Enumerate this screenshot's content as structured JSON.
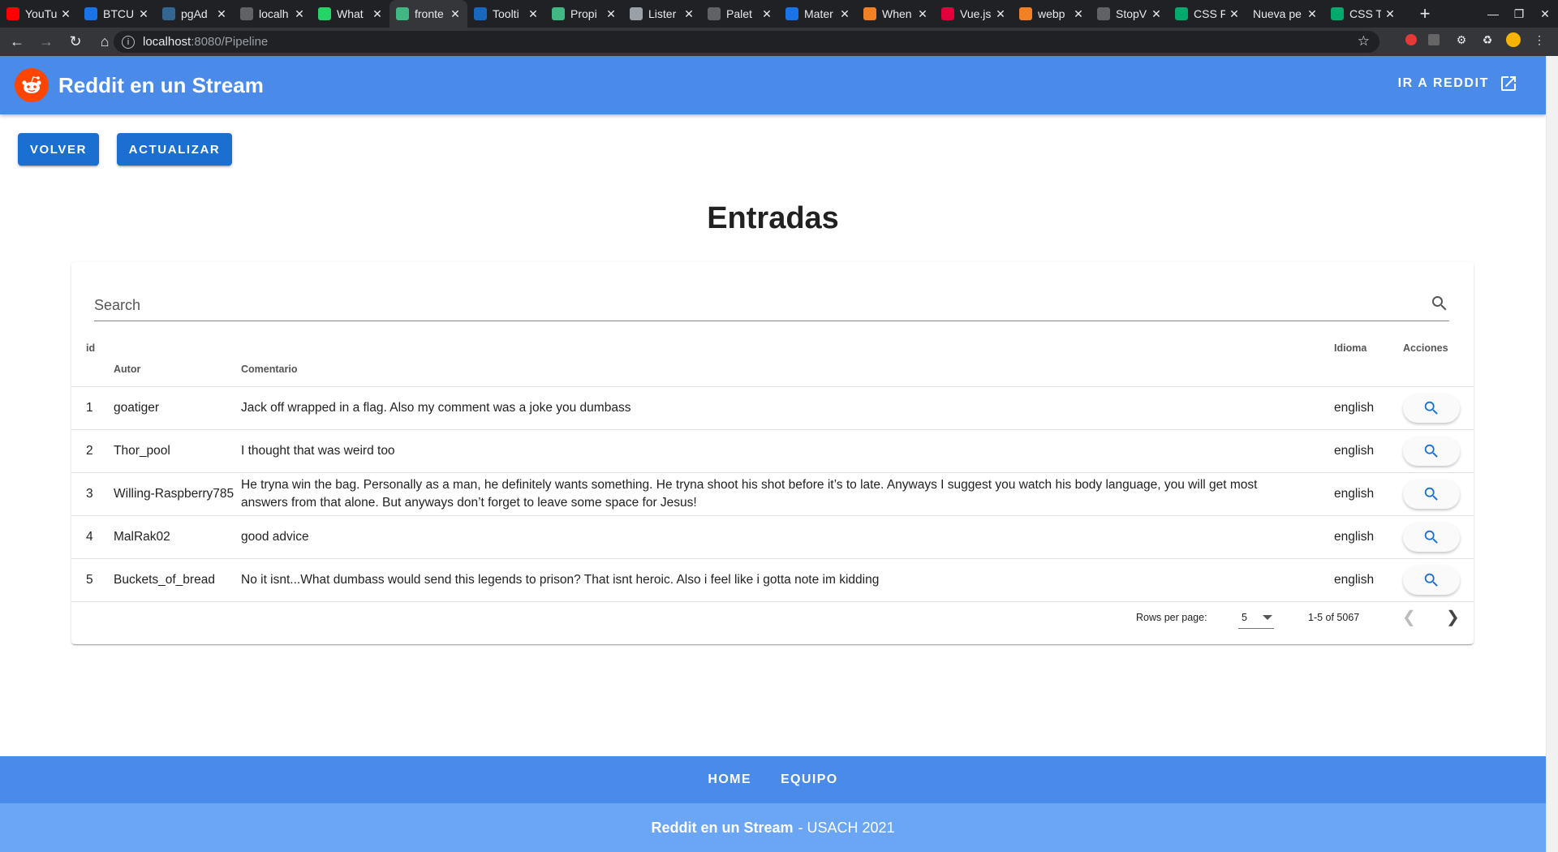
{
  "browser": {
    "tabs": [
      {
        "label": "YouTu",
        "icon": "youtube-icon",
        "color": "#ff0000"
      },
      {
        "label": "BTCU",
        "icon": "cloud-icon",
        "color": "#1a73e8"
      },
      {
        "label": "pgAd",
        "icon": "postgres-icon",
        "color": "#336791"
      },
      {
        "label": "localh",
        "icon": "globe-icon",
        "color": "#5f6368"
      },
      {
        "label": "What",
        "icon": "whatsapp-icon",
        "color": "#25d366"
      },
      {
        "label": "fronte",
        "icon": "vue-icon",
        "color": "#41b883"
      },
      {
        "label": "Toolti",
        "icon": "vuetify-icon",
        "color": "#1867c0"
      },
      {
        "label": "Propi",
        "icon": "vue-icon",
        "color": "#41b883"
      },
      {
        "label": "Lister",
        "icon": "ring-icon",
        "color": "#9aa0a6"
      },
      {
        "label": "Palet",
        "icon": "palette-icon",
        "color": "#5f6368"
      },
      {
        "label": "Mater",
        "icon": "material-icon",
        "color": "#1a73e8"
      },
      {
        "label": "When",
        "icon": "stackoverflow-icon",
        "color": "#f48024"
      },
      {
        "label": "Vue.js",
        "icon": "tp-icon",
        "color": "#e0003b"
      },
      {
        "label": "webp",
        "icon": "stackoverflow-icon",
        "color": "#f48024"
      },
      {
        "label": "StopV",
        "icon": "globe-icon",
        "color": "#5f6368"
      },
      {
        "label": "CSS F",
        "icon": "w3-icon",
        "color": "#04aa6d"
      },
      {
        "label": "Nueva pe",
        "icon": "",
        "color": "#202124"
      },
      {
        "label": "CSS T",
        "icon": "w3-icon",
        "color": "#04aa6d"
      }
    ],
    "url_host": "localhost",
    "url_path": ":8080/Pipeline"
  },
  "appbar": {
    "title": "Reddit en un Stream",
    "link_label": "IR A REDDIT"
  },
  "actions": {
    "back_label": "VOLVER",
    "refresh_label": "ACTUALIZAR"
  },
  "page_title": "Entradas",
  "search": {
    "placeholder": "Search"
  },
  "table": {
    "headers": {
      "id": "id",
      "autor": "Autor",
      "comentario": "Comentario",
      "idioma": "Idioma",
      "acciones": "Acciones"
    },
    "rows": [
      {
        "id": "1",
        "autor": "goatiger",
        "comentario": "Jack off wrapped in a flag. Also my comment was a joke you dumbass",
        "idioma": "english"
      },
      {
        "id": "2",
        "autor": "Thor_pool",
        "comentario": "I thought that was weird too",
        "idioma": "english"
      },
      {
        "id": "3",
        "autor": "Willing-Raspberry785",
        "comentario": "He tryna win the bag. Personally as a man, he definitely wants something. He tryna shoot his shot before it’s to late. Anyways I suggest you watch his body language, you will get most answers from that alone. But anyways don’t forget to leave some space for Jesus!",
        "idioma": "english"
      },
      {
        "id": "4",
        "autor": "MalRak02",
        "comentario": "good advice",
        "idioma": "english"
      },
      {
        "id": "5",
        "autor": "Buckets_of_bread",
        "comentario": "No it isnt...What dumbass would send this legends to prison? That isnt heroic. Also i feel like i gotta note im kidding",
        "idioma": "english"
      }
    ],
    "footer": {
      "rows_per_page_label": "Rows per page:",
      "rows_per_page_value": "5",
      "range": "1-5 of 5067"
    }
  },
  "footer": {
    "nav": [
      "HOME",
      "EQUIPO"
    ],
    "brand": "Reddit en un Stream",
    "suffix": "- USACH 2021"
  },
  "colors": {
    "appbar": "#4a8ae8",
    "button": "#1a6fd1",
    "footer_top": "#4a8ae8",
    "footer_bottom": "#6aa6f4",
    "reddit": "#ff4500"
  }
}
